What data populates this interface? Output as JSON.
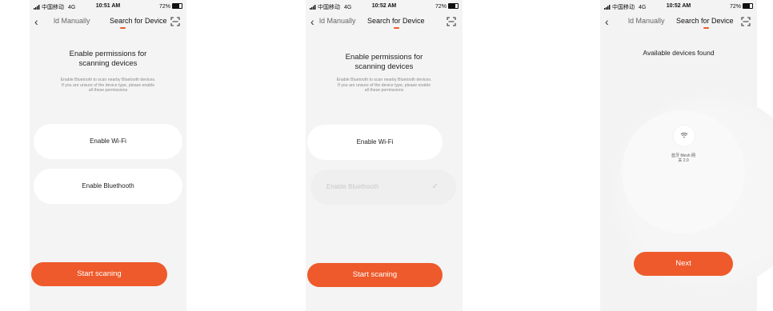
{
  "colors": {
    "accent": "#ee5a2b",
    "screen_bg": "#f4f4f4",
    "card_bg": "#ffffff"
  },
  "screens": [
    {
      "status": {
        "carrier": "中国移动",
        "network": "4G",
        "time": "10:51 AM",
        "battery": "72%"
      },
      "nav": {
        "tab_left": "ld Manually",
        "tab_right": "Search for Device"
      },
      "title_line1": "Enable permissions for",
      "title_line2": "scanning devices",
      "desc_line1": "Enable Bluetooth to scan nearby Bluetooth devices.",
      "desc_line2": "If you are unsure of the device type, please enable",
      "desc_line3": "all these permissions",
      "wifi_label": "Enable Wi-Fi",
      "bluetooth_label": "Enable Bluethooth",
      "cta_label": "Start scaning"
    },
    {
      "status": {
        "carrier": "中国移动",
        "network": "4G",
        "time": "10:52 AM",
        "battery": "72%"
      },
      "nav": {
        "tab_left": "ld Manually",
        "tab_right": "Search for Device"
      },
      "title_line1": "Enable permissions for",
      "title_line2": "scanning devices",
      "desc_line1": "Enable Bluetooth to scan nearby Bluetooth devices.",
      "desc_line2": "If you are unsure of the device type, please enable",
      "desc_line3": "all these permissions",
      "wifi_label": "Enable Wi-Fi",
      "bluetooth_label": "Enable Bluethooth",
      "bluetooth_check": "✓",
      "cta_label": "Start scaning"
    },
    {
      "status": {
        "carrier": "中国移动",
        "network": "4G",
        "time": "10:52 AM",
        "battery": "72%"
      },
      "nav": {
        "tab_left": "ld Manually",
        "tab_right": "Search for Device"
      },
      "found_title": "Available devices found",
      "device_icon": "wifi-icon",
      "device_name_line1": "蓝牙 Mesh 网",
      "device_name_line2": "关 2.0",
      "cta_label": "Next"
    }
  ]
}
